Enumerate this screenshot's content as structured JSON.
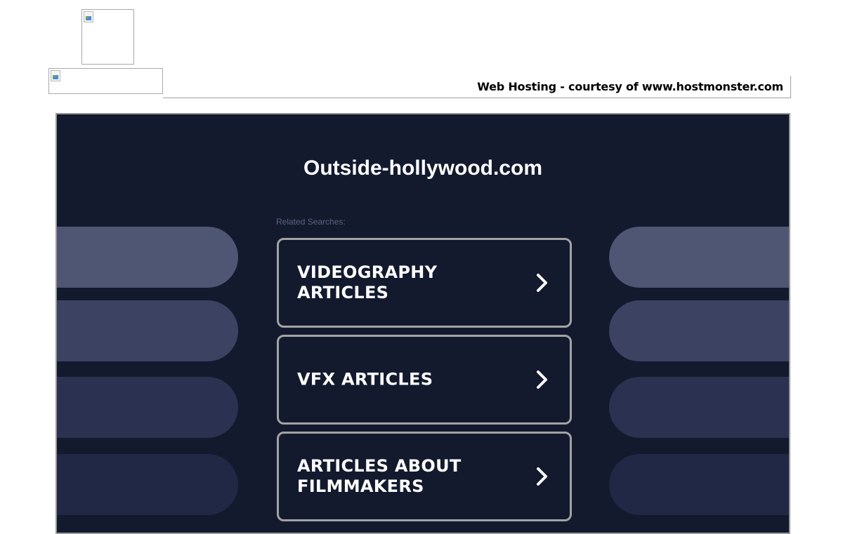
{
  "hosting_credit": "Web Hosting - courtesy of www.hostmonster.com",
  "parked_page": {
    "title": "Outside-hollywood.com",
    "related_label": "Related Searches:",
    "links": [
      {
        "label": "VIDEOGRAPHY ARTICLES"
      },
      {
        "label": "VFX ARTICLES"
      },
      {
        "label": "ARTICLES ABOUT FILMMAKERS"
      }
    ]
  },
  "colors": {
    "page_background": "#131a2e",
    "button_border": "#a3a3a3",
    "pill_shades": [
      "#4e5674",
      "#3b4262",
      "#2b3150",
      "#202846"
    ]
  },
  "icons": {
    "link_chevron": "chevron-right-icon",
    "broken_image": "broken-image-icon"
  }
}
